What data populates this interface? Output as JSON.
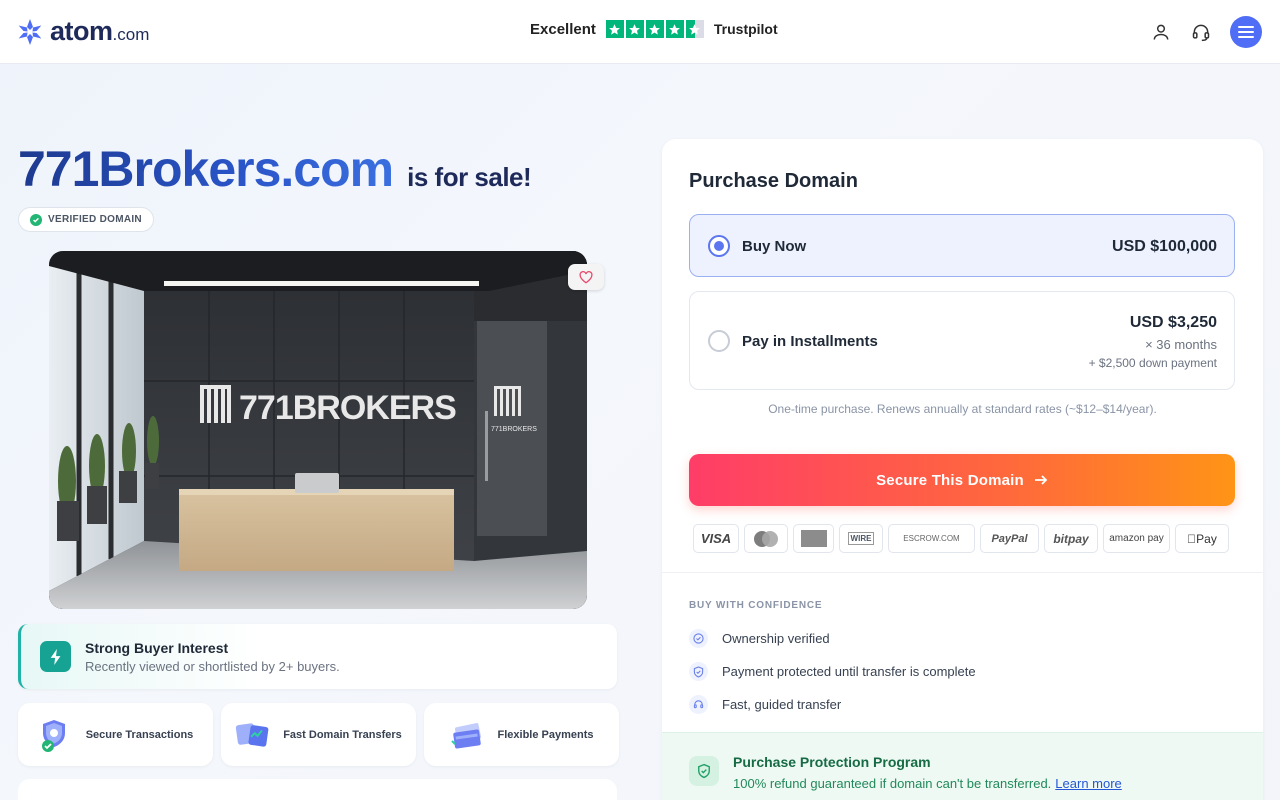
{
  "header": {
    "brand": "atom",
    "brand_tld": ".com",
    "trust_label": "Excellent",
    "trust_brand": "Trustpilot",
    "trust_rating_stars": 4.5,
    "accent": "#4f6df5",
    "trustpilot_color": "#00b67a"
  },
  "listing": {
    "domain": "771Brokers.com",
    "for_sale": "is for sale!",
    "verified_badge": "VERIFIED DOMAIN",
    "hero_sign": "771BROKERS",
    "hero_sign_small": "771BROKERS",
    "interest_title": "Strong Buyer Interest",
    "interest_sub": "Recently viewed or shortlisted by 2+ buyers.",
    "features": [
      {
        "label": "Secure Transactions",
        "icon": "shield-lock-icon"
      },
      {
        "label": "Fast Domain Transfers",
        "icon": "transfer-icon"
      },
      {
        "label": "Flexible Payments",
        "icon": "cards-icon"
      }
    ]
  },
  "purchase": {
    "title": "Purchase Domain",
    "buy_now": {
      "label": "Buy Now",
      "price": "USD $100,000"
    },
    "installments": {
      "label": "Pay in Installments",
      "price": "USD $3,250",
      "months": "× 36 months",
      "down": "+ $2,500 down payment"
    },
    "renew_note": "One-time purchase. Renews annually at standard rates (~$12–$14/year).",
    "cta": "Secure This Domain",
    "payment_methods": [
      "VISA",
      "Mastercard",
      "AMEX",
      "WIRE",
      "ESCROW.COM",
      "PayPal",
      "bitpay",
      "amazon pay",
      "Pay"
    ],
    "confidence_heading": "BUY WITH CONFIDENCE",
    "confidence_items": [
      "Ownership verified",
      "Payment protected until transfer is complete",
      "Fast, guided transfer"
    ],
    "protection_title": "Purchase Protection Program",
    "protection_sub": "100% refund guaranteed if domain can't be transferred.",
    "protection_link": "Learn more"
  }
}
